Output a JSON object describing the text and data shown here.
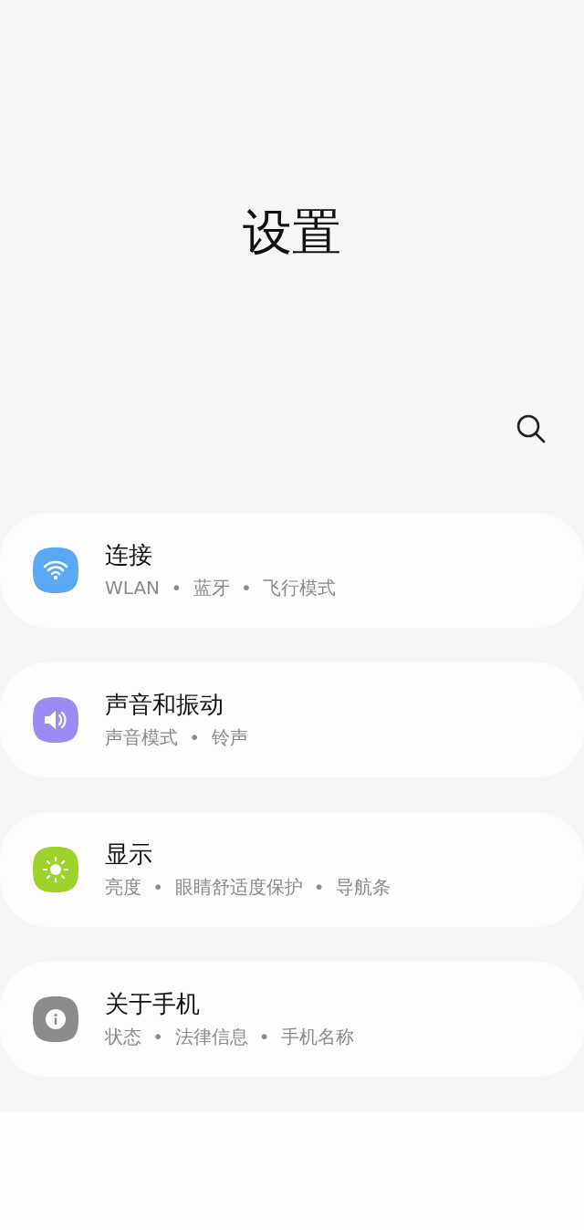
{
  "header": {
    "title": "设置"
  },
  "items": [
    {
      "kind": "wifi",
      "color": "#5aa8f5",
      "title": "连接",
      "subtitle": "WLAN • 蓝牙 • 飞行模式"
    },
    {
      "kind": "sound",
      "color": "#9a8cf2",
      "title": "声音和振动",
      "subtitle": "声音模式 • 铃声"
    },
    {
      "kind": "display",
      "color": "#9dd22b",
      "title": "显示",
      "subtitle": "亮度 • 眼睛舒适度保护 • 导航条"
    },
    {
      "kind": "info",
      "color": "#8c8c8c",
      "title": "关于手机",
      "subtitle": "状态 • 法律信息 • 手机名称"
    }
  ]
}
